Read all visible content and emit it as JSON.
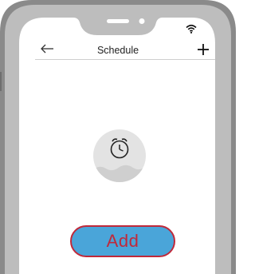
{
  "header": {
    "title": "Schedule",
    "back_icon": "arrow-left-icon",
    "add_icon": "plus-icon"
  },
  "status_bar": {
    "wifi_icon": "wifi-icon"
  },
  "empty_state": {
    "icon": "alarm-clock-icon"
  },
  "actions": {
    "add_label": "Add"
  },
  "colors": {
    "frame": "#8a8a8a",
    "button_fill": "#4aa5d9",
    "button_border": "#c0293a",
    "button_text": "#c0293a",
    "illustration_bg": "#e3e3e3",
    "illustration_wave": "#cfcfcf"
  }
}
